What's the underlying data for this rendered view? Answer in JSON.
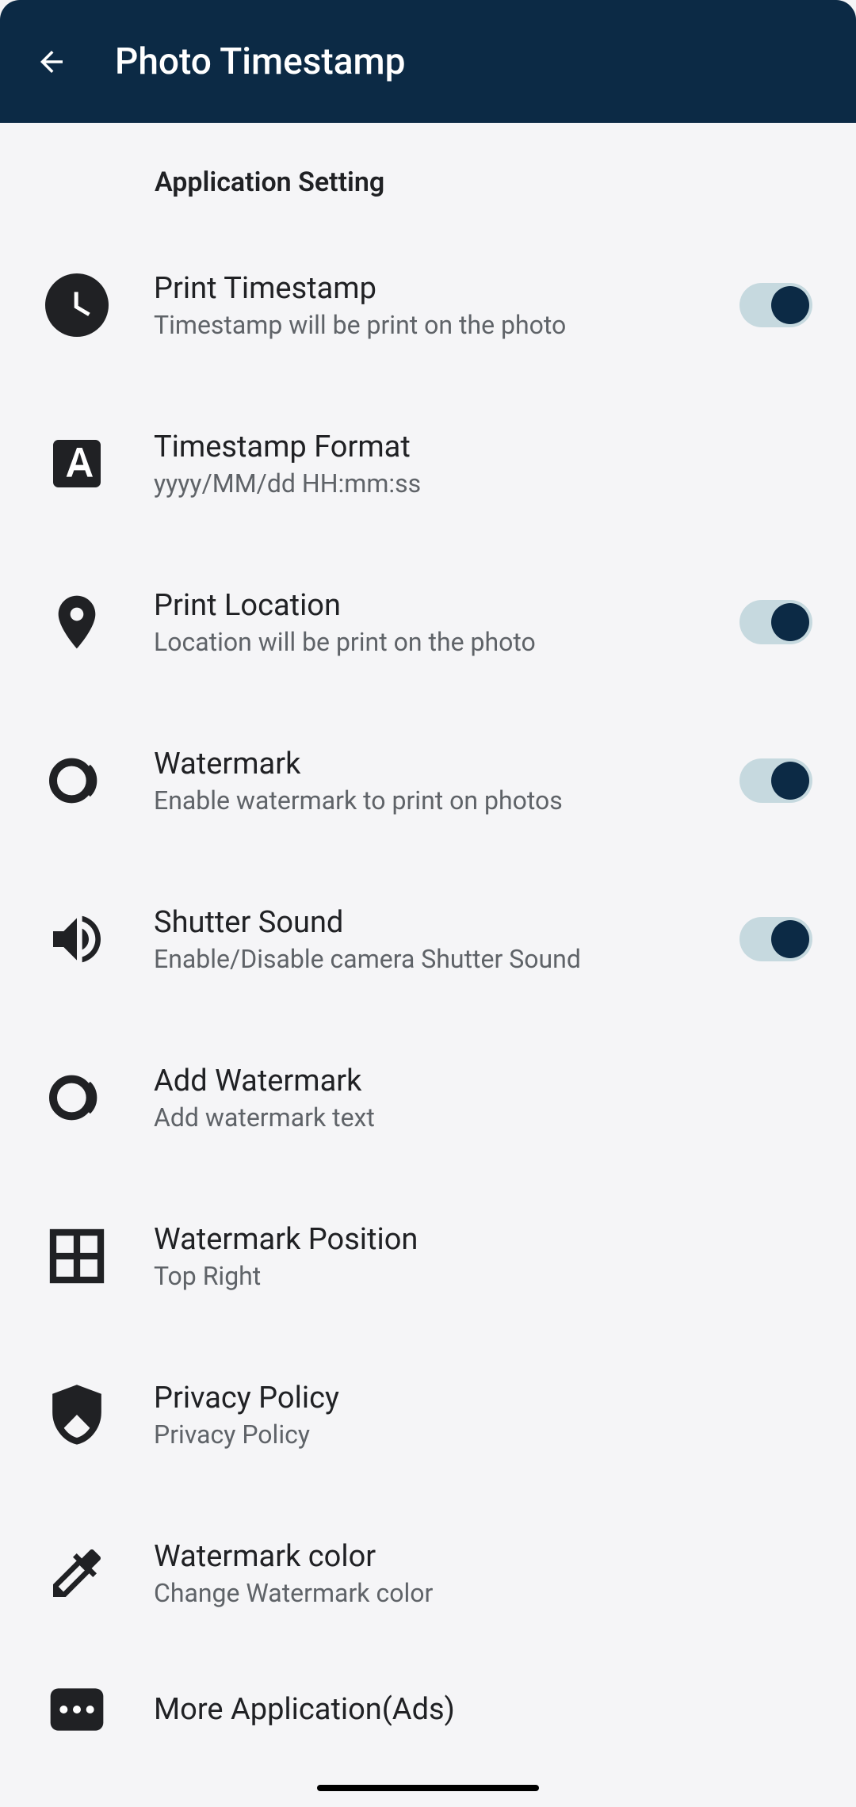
{
  "header": {
    "title": "Photo Timestamp"
  },
  "section": {
    "title": "Application Setting"
  },
  "settings": {
    "print_timestamp": {
      "title": "Print Timestamp",
      "subtitle": "Timestamp will be print on the photo",
      "enabled": true
    },
    "timestamp_format": {
      "title": "Timestamp Format",
      "subtitle": "yyyy/MM/dd HH:mm:ss"
    },
    "print_location": {
      "title": "Print Location",
      "subtitle": "Location will be print on the photo",
      "enabled": true
    },
    "watermark": {
      "title": "Watermark",
      "subtitle": "Enable watermark to print on photos",
      "enabled": true
    },
    "shutter_sound": {
      "title": "Shutter Sound",
      "subtitle": "Enable/Disable camera Shutter Sound",
      "enabled": true
    },
    "add_watermark": {
      "title": "Add Watermark",
      "subtitle": "Add watermark text"
    },
    "watermark_position": {
      "title": "Watermark Position",
      "subtitle": "Top Right"
    },
    "privacy_policy": {
      "title": "Privacy Policy",
      "subtitle": "Privacy Policy"
    },
    "watermark_color": {
      "title": "Watermark color",
      "subtitle": "Change Watermark color"
    },
    "more_apps": {
      "title": "More Application(Ads)"
    }
  }
}
